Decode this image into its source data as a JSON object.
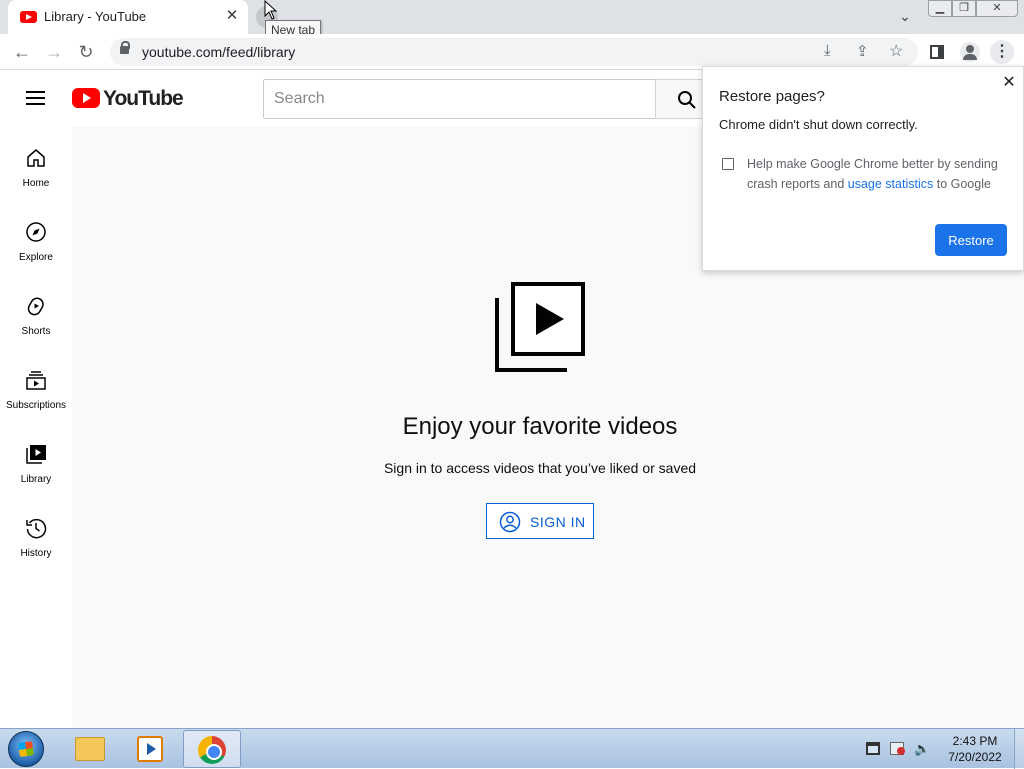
{
  "browser": {
    "tab_title": "Library - YouTube",
    "tab_close": "✕",
    "tooltip": "New tab",
    "url": "youtube.com/feed/library",
    "window_controls": {
      "minimize": "▁",
      "maximize": "❐",
      "close": "✕"
    }
  },
  "youtube": {
    "logo_text": "YouTube",
    "search_placeholder": "Search",
    "sidebar": [
      {
        "label": "Home",
        "icon": "home-icon"
      },
      {
        "label": "Explore",
        "icon": "compass-icon"
      },
      {
        "label": "Shorts",
        "icon": "shorts-icon"
      },
      {
        "label": "Subscriptions",
        "icon": "subscriptions-icon"
      },
      {
        "label": "Library",
        "icon": "library-icon"
      },
      {
        "label": "History",
        "icon": "history-icon"
      }
    ],
    "main": {
      "heading": "Enjoy your favorite videos",
      "subtext": "Sign in to access videos that you’ve liked or saved",
      "sign_in": "SIGN IN"
    }
  },
  "restore_popup": {
    "title": "Restore pages?",
    "message": "Chrome didn't shut down correctly.",
    "checkbox_text": "Help make Google Chrome better by sending crash reports and",
    "link_text": "usage statistics",
    "checkbox_text_end": "to Google",
    "restore_button": "Restore",
    "close": "✕"
  },
  "taskbar": {
    "time": "2:43 PM",
    "date": "7/20/2022"
  },
  "colors": {
    "yt_red": "#ff0000",
    "link_blue": "#065fd4",
    "chrome_blue": "#1a73e8"
  }
}
